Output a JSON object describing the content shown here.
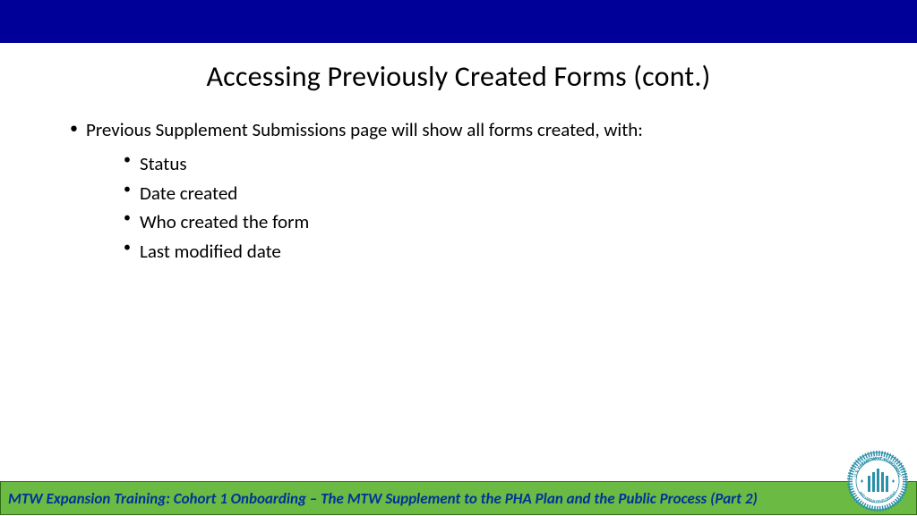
{
  "title": "Accessing Previously Created Forms (cont.)",
  "bullet_main": "Previous Supplement Submissions page will show all forms created, with:",
  "sub_bullets": {
    "b0": "Status",
    "b1": "Date created",
    "b2": "Who created the form",
    "b3": "Last modified date"
  },
  "footer_text": "MTW Expansion Training: Cohort 1 Onboarding – The MTW Supplement to the PHA Plan and the Public Process (Part 2)",
  "colors": {
    "top_bar": "#000099",
    "footer_bg": "#6aba44",
    "footer_text": "#003399"
  }
}
